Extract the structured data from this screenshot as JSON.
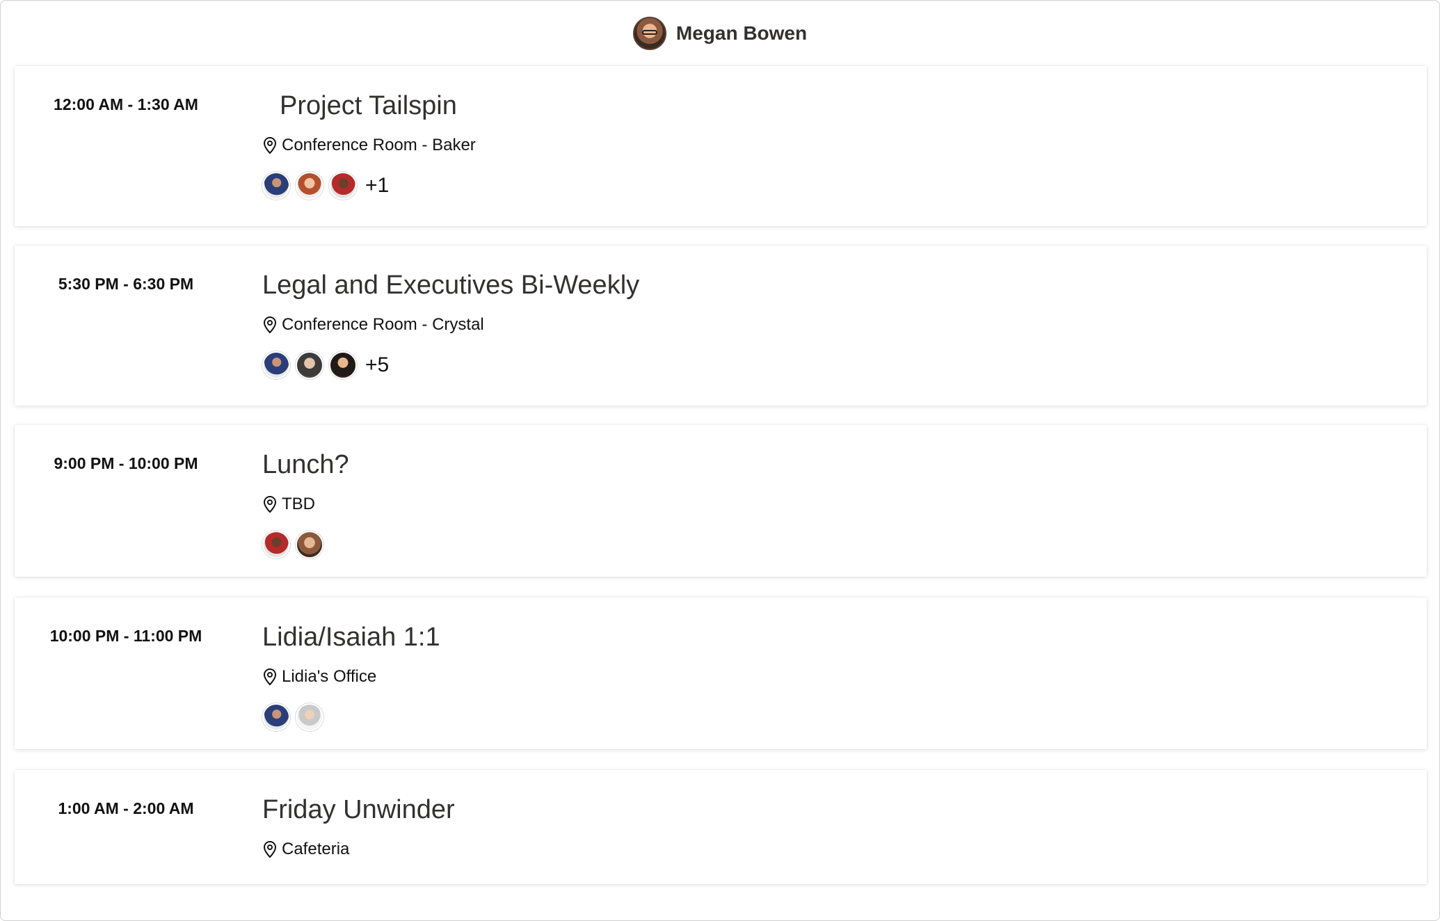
{
  "header": {
    "name": "Megan Bowen"
  },
  "events": [
    {
      "time": "12:00 AM - 1:30 AM",
      "title": "Project Tailspin",
      "location": "Conference Room - Baker",
      "more": "+1"
    },
    {
      "time": "5:30 PM - 6:30 PM",
      "title": "Legal and Executives Bi-Weekly",
      "location": "Conference Room - Crystal",
      "more": "+5"
    },
    {
      "time": "9:00 PM - 10:00 PM",
      "title": "Lunch?",
      "location": "TBD"
    },
    {
      "time": "10:00 PM - 11:00 PM",
      "title": "Lidia/Isaiah 1:1",
      "location": "Lidia's Office"
    },
    {
      "time": "1:00 AM - 2:00 AM",
      "title": "Friday Unwinder",
      "location": "Cafeteria"
    }
  ]
}
